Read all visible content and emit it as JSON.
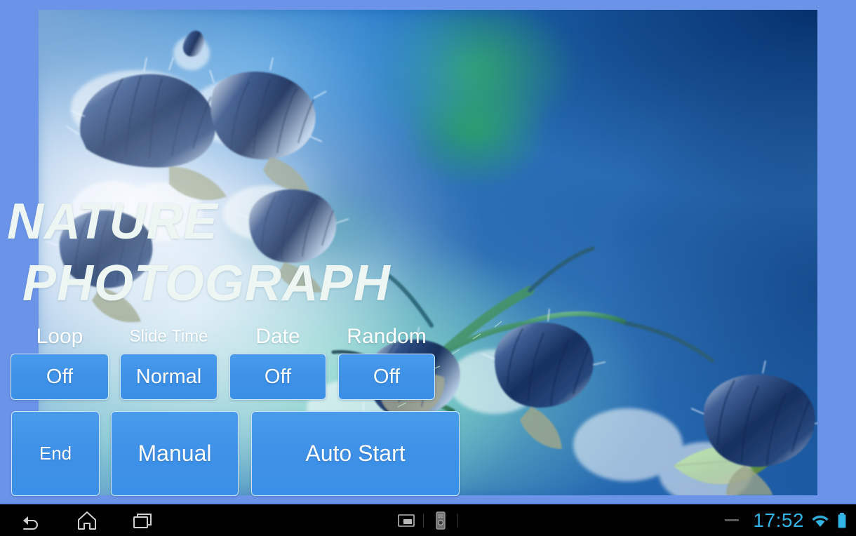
{
  "app": {
    "title_line1": "NATURE",
    "title_line2": "PHOTOGRAPH"
  },
  "theme": {
    "frame_border": "#6b93e8",
    "button_fill": "#3e91e7",
    "button_border": "#cfe6fb",
    "button_text": "#ffffff",
    "title_text": "#eef6f4",
    "status_accent": "#33b5e5",
    "system_bar_bg": "#000000"
  },
  "controls": {
    "toggles": [
      {
        "label": "Loop",
        "value": "Off",
        "icon": "loop-toggle"
      },
      {
        "label": "Slide Time",
        "value": "Normal",
        "icon": "slide-time-toggle"
      },
      {
        "label": "Date",
        "value": "Off",
        "icon": "date-toggle"
      },
      {
        "label": "Random",
        "value": "Off",
        "icon": "random-toggle"
      }
    ],
    "actions": [
      {
        "label": "End"
      },
      {
        "label": "Manual"
      },
      {
        "label": "Auto Start"
      }
    ]
  },
  "photo": {
    "subject": "frost covered blue flower buds on green stems",
    "description": "blurred blue and green bokeh background with blue gradient"
  },
  "system_bar": {
    "nav": [
      {
        "icon": "back-icon",
        "label": "Back"
      },
      {
        "icon": "home-icon",
        "label": "Home"
      },
      {
        "icon": "recents-icon",
        "label": "Recent apps"
      }
    ],
    "notifications": [
      {
        "icon": "screenshot-icon"
      },
      {
        "icon": "usb-device-icon"
      }
    ],
    "status": {
      "dash": "minus-icon",
      "clock": "17:52",
      "wifi": "wifi-icon",
      "battery": "battery-full-icon"
    }
  }
}
